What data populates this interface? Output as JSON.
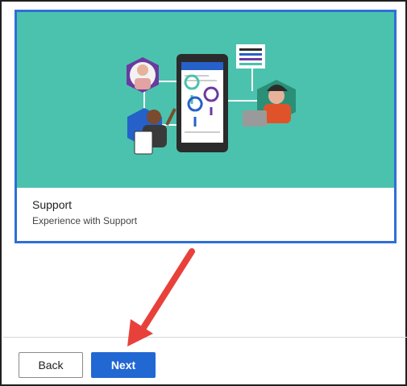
{
  "card": {
    "title": "Support",
    "description": "Experience with Support",
    "illustration": "support-scene-illustration"
  },
  "buttons": {
    "back_label": "Back",
    "next_label": "Next"
  },
  "annotation": {
    "arrow_color": "#e8413b",
    "arrow_target": "next-button"
  },
  "colors": {
    "accent": "#2268d3",
    "card_border": "#2f6fd6",
    "illustration_bg": "#4bc2ad"
  }
}
